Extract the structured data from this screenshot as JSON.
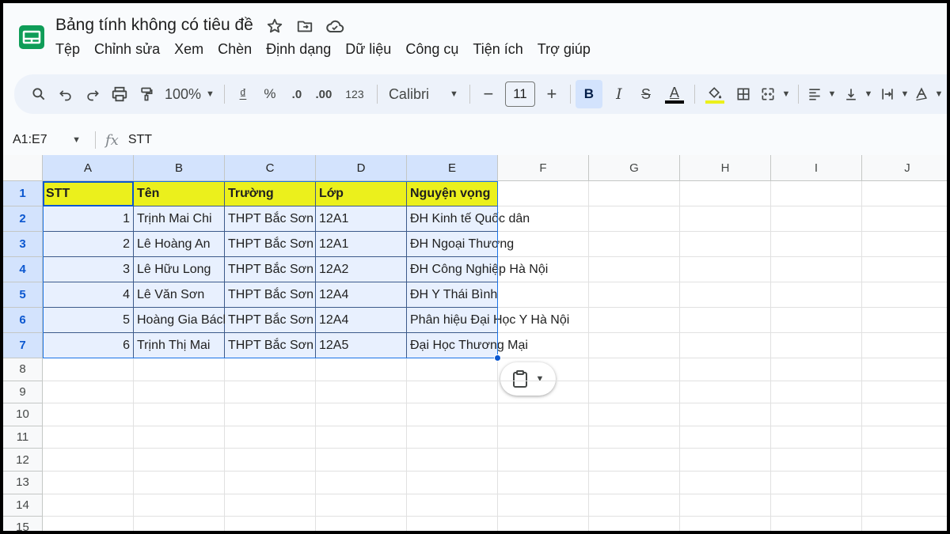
{
  "app": {
    "doc_title": "Bảng tính không có tiêu đề",
    "menu": [
      "Tệp",
      "Chỉnh sửa",
      "Xem",
      "Chèn",
      "Định dạng",
      "Dữ liệu",
      "Công cụ",
      "Tiện ích",
      "Trợ giúp"
    ]
  },
  "toolbar": {
    "zoom": "100%",
    "currency": "₫",
    "percent": "%",
    "dec_decrease": ".0",
    "dec_increase": ".00",
    "number_format": "123",
    "font": "Calibri",
    "minus": "−",
    "font_size": "11",
    "plus": "+",
    "bold": "B",
    "italic": "I",
    "strike": "S",
    "text_color": "A",
    "text_color_hex": "#000000",
    "fill_color_hex": "#ebf01c"
  },
  "formula_bar": {
    "name_box": "A1:E7",
    "fx": "fx",
    "value": "STT"
  },
  "grid": {
    "columns": [
      "A",
      "B",
      "C",
      "D",
      "E",
      "F",
      "G",
      "H",
      "I",
      "J"
    ],
    "rows": [
      "1",
      "2",
      "3",
      "4",
      "5",
      "6",
      "7",
      "8",
      "9",
      "10",
      "11",
      "12",
      "13",
      "14",
      "15"
    ],
    "header_row": [
      "STT",
      "Tên",
      "Trường",
      "Lớp",
      "Nguyện vọng"
    ],
    "data": [
      [
        "1",
        "Trịnh Mai Chi",
        "THPT Bắc Sơn",
        "12A1",
        "ĐH Kinh tế Quốc dân"
      ],
      [
        "2",
        "Lê Hoàng An",
        "THPT Bắc Sơn",
        "12A1",
        "ĐH Ngoại Thương"
      ],
      [
        "3",
        "Lê Hữu Long",
        "THPT Bắc Sơn",
        "12A2",
        "ĐH Công Nghiệp Hà Nội"
      ],
      [
        "4",
        "Lê Văn Sơn",
        "THPT Bắc Sơn",
        "12A4",
        "ĐH Y Thái Bình"
      ],
      [
        "5",
        "Hoàng Gia Bách",
        "THPT Bắc Sơn",
        "12A4",
        "Phân hiệu Đại Học Y Hà Nội"
      ],
      [
        "6",
        "Trịnh Thị Mai",
        "THPT Bắc Sơn",
        "12A5",
        "Đại Học Thương Mại"
      ]
    ],
    "highlight_color": "#ebf01c",
    "selection_color": "#1a73e8"
  }
}
